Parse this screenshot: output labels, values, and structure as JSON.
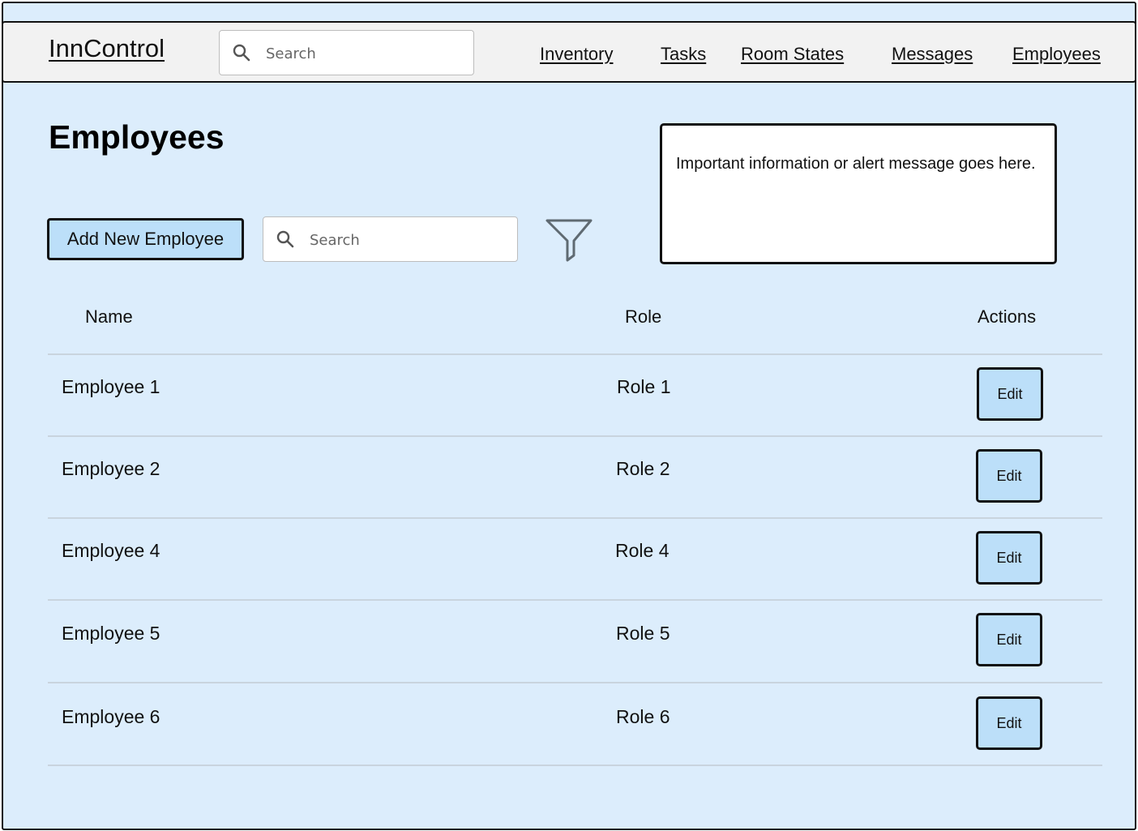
{
  "app": {
    "brand": "InnControl",
    "search_placeholder": "Search"
  },
  "nav": {
    "items": [
      {
        "label": "Inventory"
      },
      {
        "label": "Tasks"
      },
      {
        "label": "Room States"
      },
      {
        "label": "Messages"
      },
      {
        "label": "Employees"
      }
    ]
  },
  "page": {
    "title": "Employees",
    "add_button_label": "Add New Employee",
    "search_placeholder": "Search",
    "filter_icon": "filter-icon",
    "alert_text": "Important information or alert message goes here."
  },
  "table": {
    "columns": [
      "Name",
      "Role",
      "Actions"
    ],
    "rows": [
      {
        "name": "Employee 1",
        "role": "Role 1",
        "action": "Edit"
      },
      {
        "name": "Employee 2",
        "role": "Role 2",
        "action": "Edit"
      },
      {
        "name": "Employee 4",
        "role": "Role 4",
        "action": "Edit"
      },
      {
        "name": "Employee 5",
        "role": "Role 5",
        "action": "Edit"
      },
      {
        "name": "Employee 6",
        "role": "Role 6",
        "action": "Edit"
      }
    ]
  },
  "colors": {
    "page_background": "#dcedfc",
    "navbar_background": "#f2f2f2",
    "button_fill": "#bcdff9",
    "outline": "#111111"
  }
}
